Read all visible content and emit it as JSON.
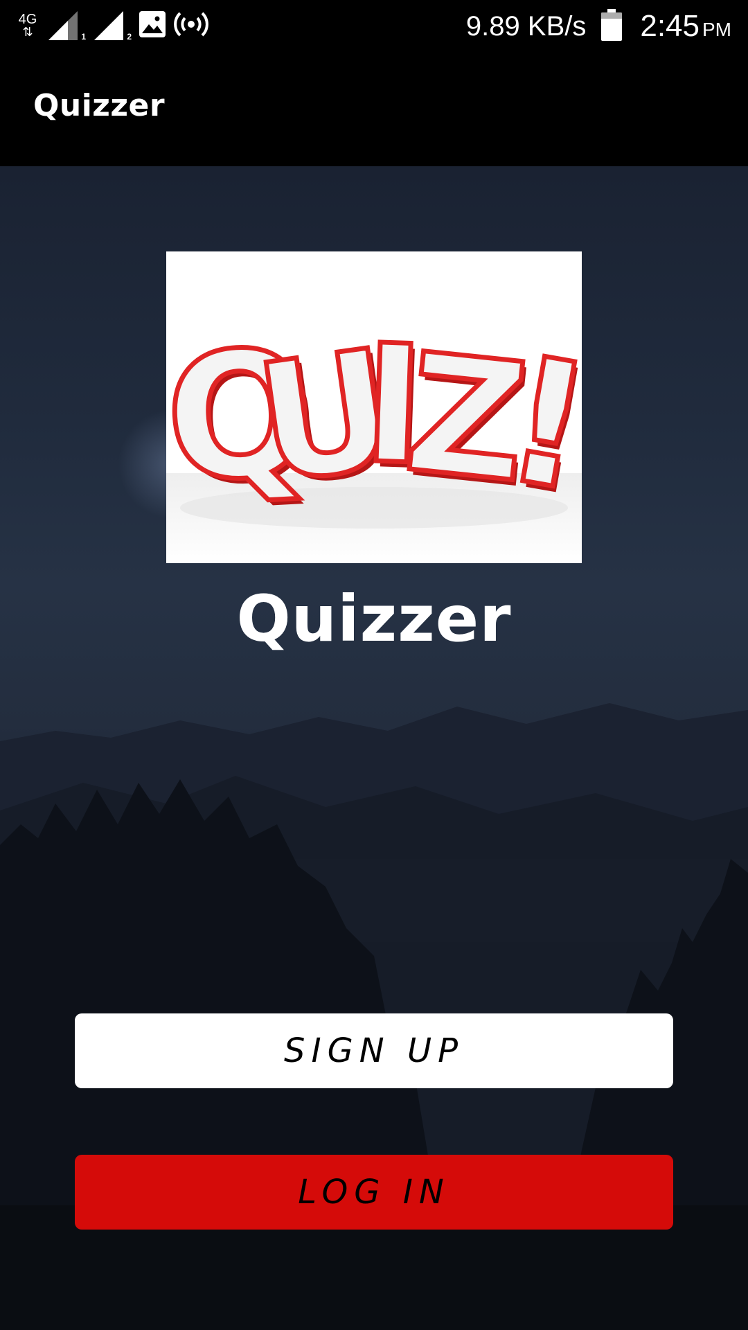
{
  "status_bar": {
    "network_type": "4G",
    "sim1": "1",
    "sim2": "2",
    "speed": "9.89 KB/s",
    "time": "2:45",
    "ampm": "PM",
    "icons": [
      "data-arrows-icon",
      "signal-sim1-icon",
      "signal-sim2-icon",
      "image-notification-icon",
      "hotspot-icon",
      "battery-icon"
    ]
  },
  "app_bar": {
    "title": "Quizzer"
  },
  "logo": {
    "text": "QUIZ!",
    "colors": {
      "face": "#f2f2f2",
      "edge": "#d21f1f"
    }
  },
  "brand": {
    "title": "Quizzer"
  },
  "buttons": {
    "signup_label": "SIGN UP",
    "login_label": "LOG IN"
  },
  "colors": {
    "login_button": "#d50b09",
    "signup_button": "#ffffff",
    "bars": "#000000"
  }
}
